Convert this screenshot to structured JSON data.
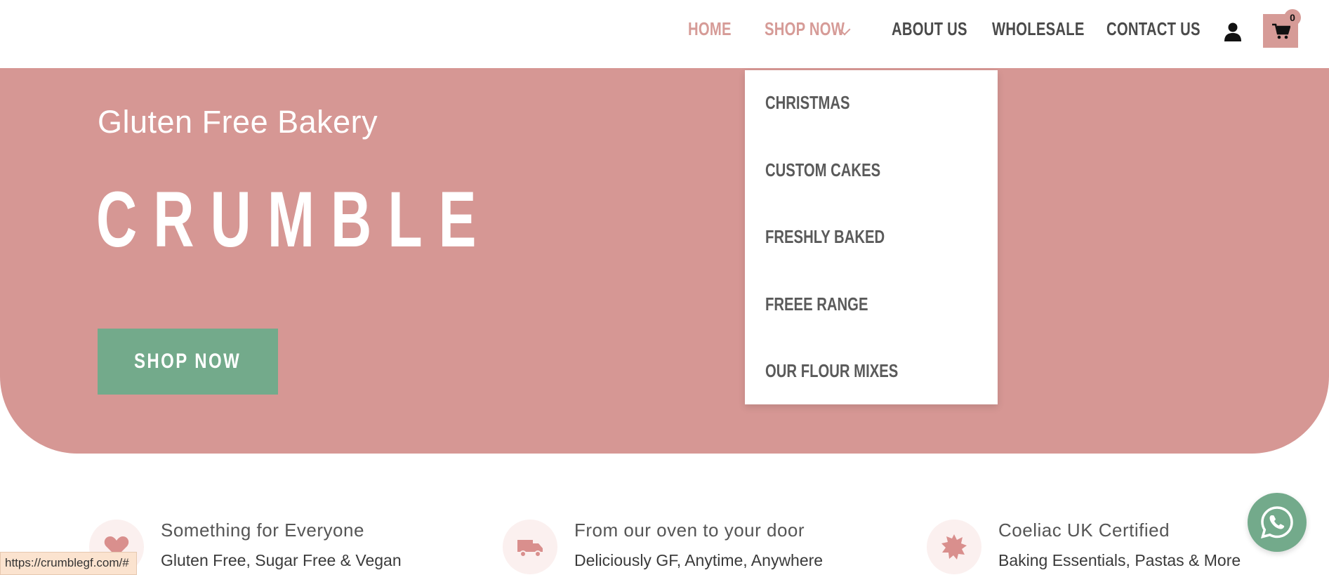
{
  "nav": {
    "items": [
      {
        "label": "HOME",
        "active": true
      },
      {
        "label": "SHOP NOW",
        "active": true
      },
      {
        "label": "ABOUT US",
        "active": false
      },
      {
        "label": "WHOLESALE",
        "active": false
      },
      {
        "label": "CONTACT US",
        "active": false
      }
    ],
    "cart_count": "0"
  },
  "hero": {
    "subtitle": "Gluten Free Bakery",
    "title": "CRUMBLE",
    "button": "SHOP NOW"
  },
  "dropdown": {
    "items": [
      "CHRISTMAS",
      "CUSTOM CAKES",
      "FRESHLY BAKED",
      "FREEE RANGE",
      "OUR FLOUR MIXES"
    ]
  },
  "features": [
    {
      "icon": "heart-icon",
      "title": "Something for Everyone",
      "text": "Gluten Free, Sugar Free & Vegan"
    },
    {
      "icon": "truck-icon",
      "title": "From our oven to your door",
      "text": "Deliciously GF, Anytime, Anywhere"
    },
    {
      "icon": "badge-icon",
      "title": "Coeliac UK Certified",
      "text": "Baking Essentials, Pastas & More"
    }
  ],
  "status_url": "https://crumblegf.com/#",
  "colors": {
    "accent": "#d69b97",
    "green": "#73aa8b",
    "text": "#4a4a4a"
  }
}
